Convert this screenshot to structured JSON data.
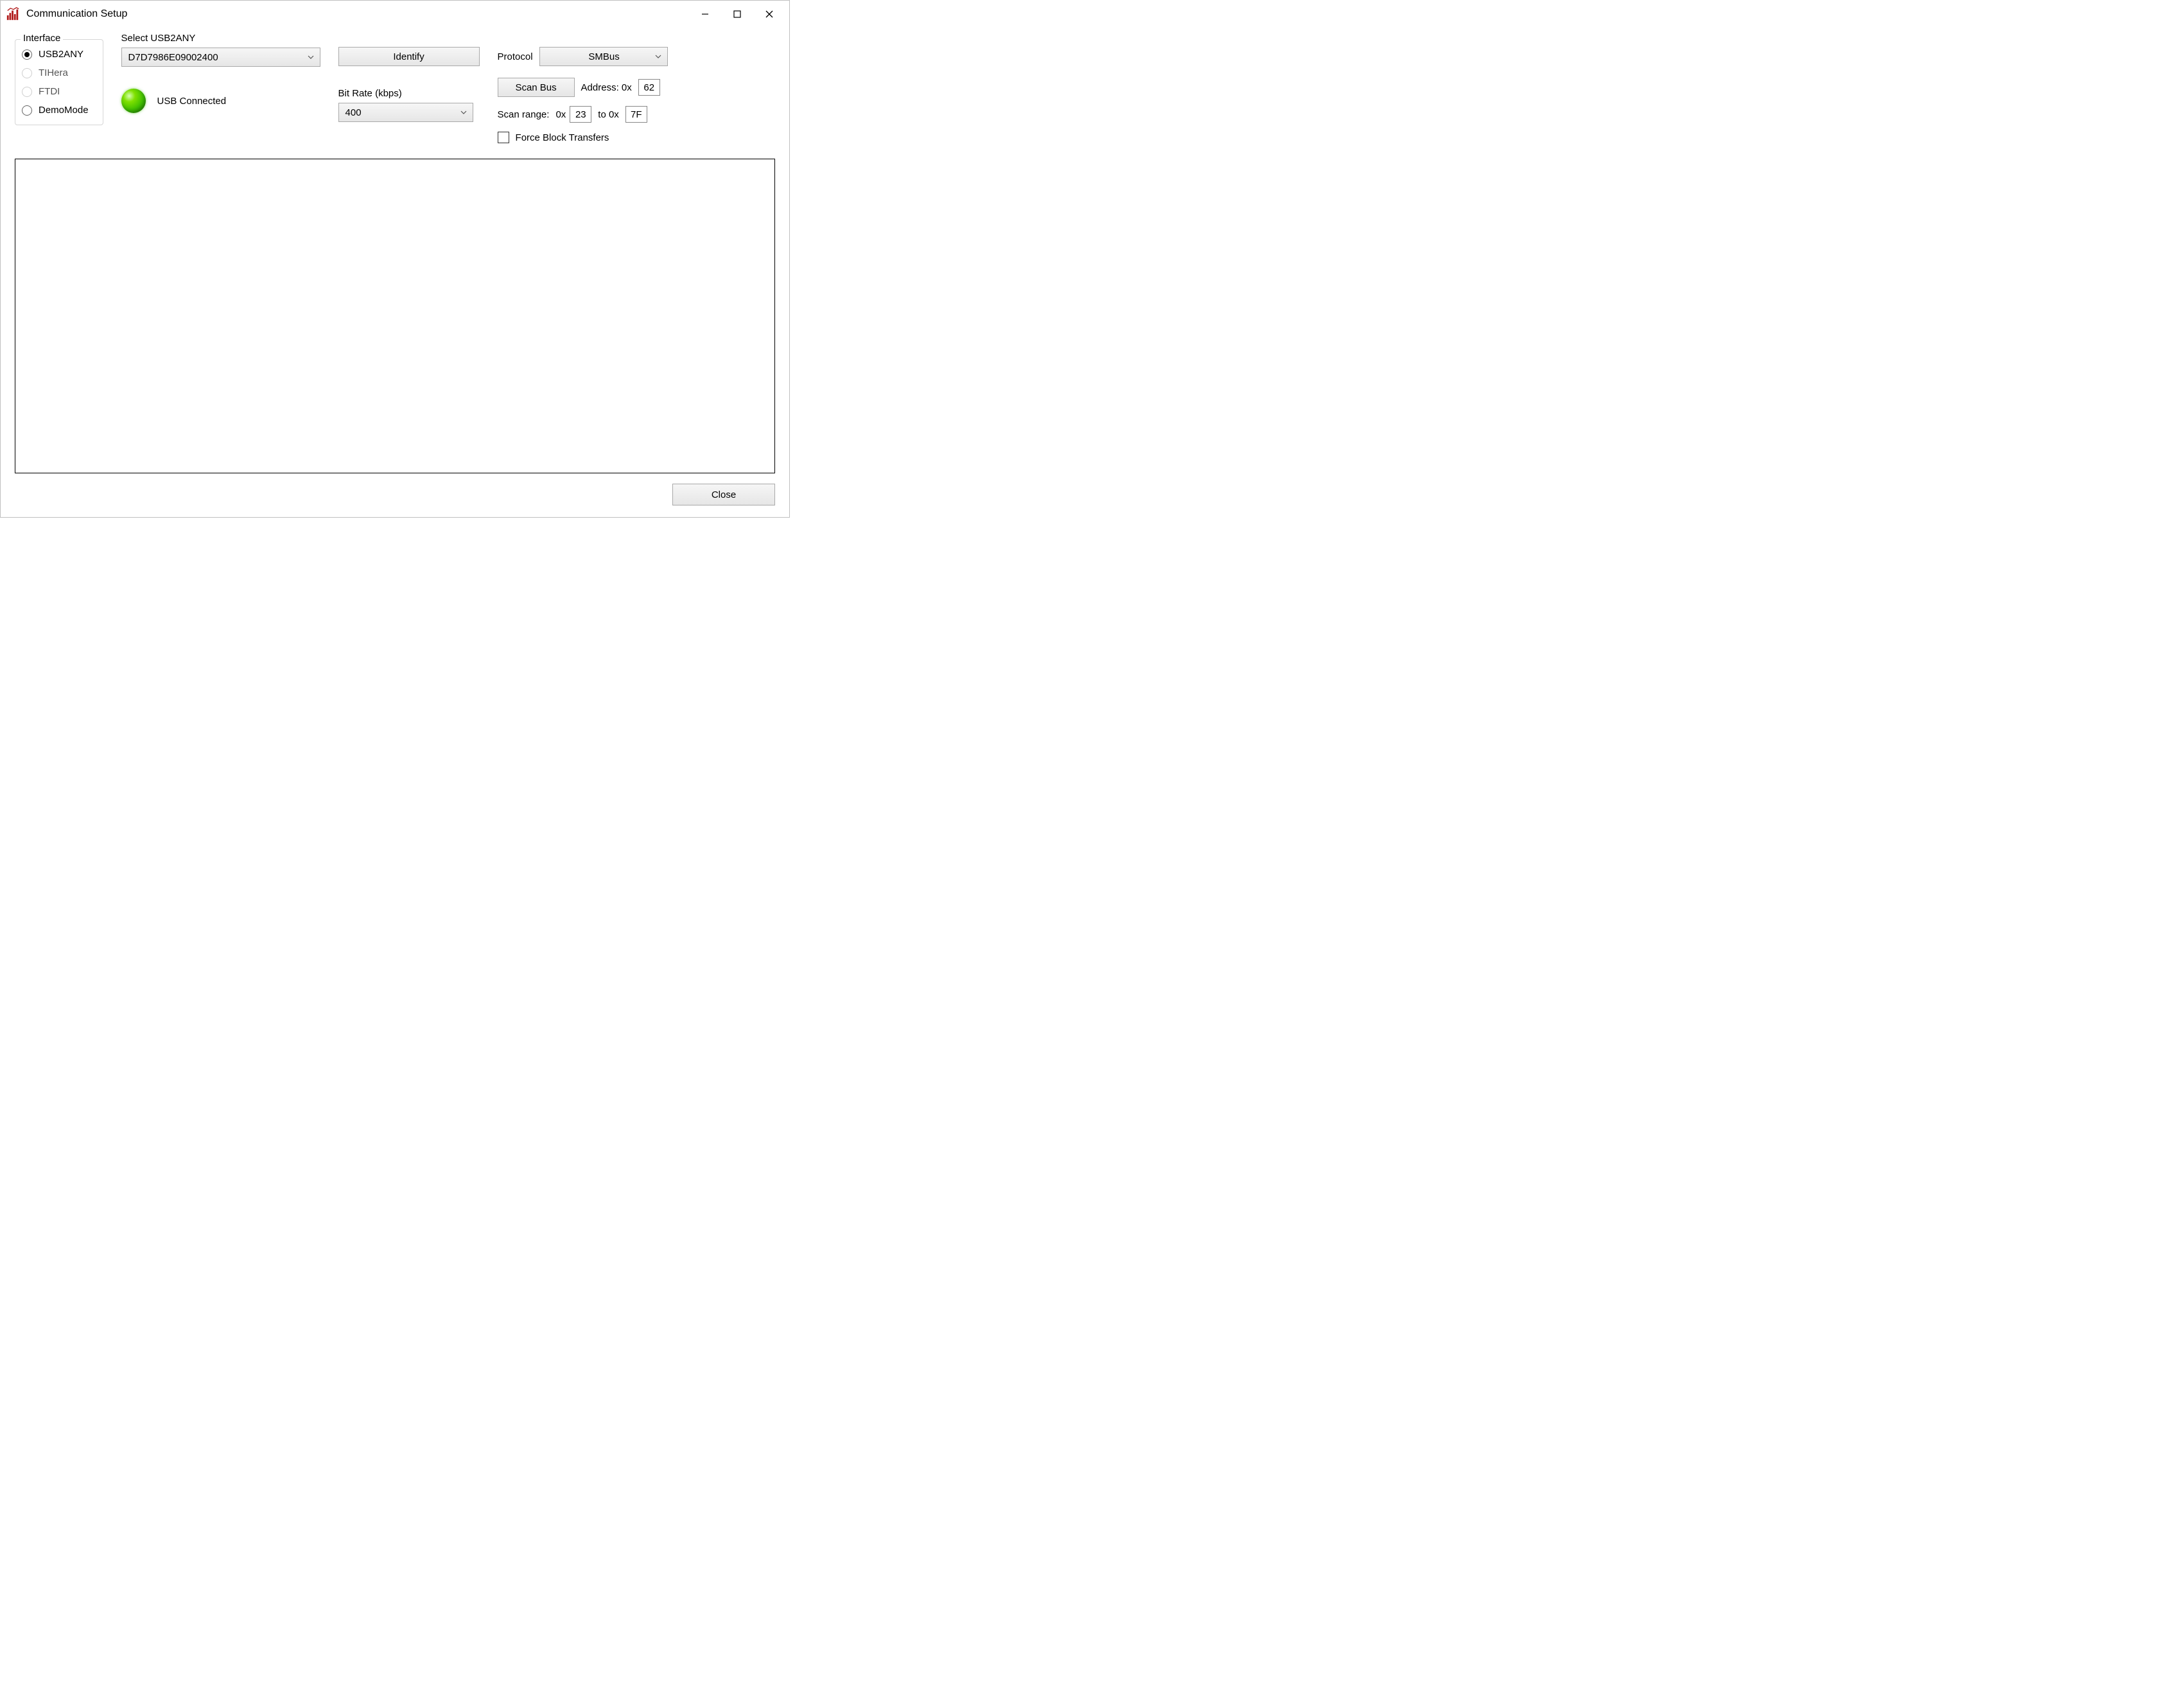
{
  "window": {
    "title": "Communication Setup"
  },
  "interface": {
    "legend": "Interface",
    "options": [
      {
        "label": "USB2ANY",
        "selected": true,
        "enabled": true
      },
      {
        "label": "TIHera",
        "selected": false,
        "enabled": false
      },
      {
        "label": "FTDI",
        "selected": false,
        "enabled": false
      },
      {
        "label": "DemoMode",
        "selected": false,
        "enabled": true
      }
    ]
  },
  "usb": {
    "select_label": "Select USB2ANY",
    "selected_device": "D7D7986E09002400",
    "status_text": "USB Connected"
  },
  "identify": {
    "label": "Identify"
  },
  "bitrate": {
    "label": "Bit Rate (kbps)",
    "value": "400"
  },
  "protocol": {
    "label": "Protocol",
    "value": "SMBus"
  },
  "scan": {
    "button_label": "Scan Bus",
    "address_label": "Address: 0x",
    "address_value": "62",
    "range_label": "Scan range:",
    "range_prefix_from": "0x",
    "range_from": "23",
    "range_to_label": "to 0x",
    "range_to": "7F"
  },
  "force_block": {
    "label": "Force Block Transfers",
    "checked": false
  },
  "footer": {
    "close_label": "Close"
  }
}
